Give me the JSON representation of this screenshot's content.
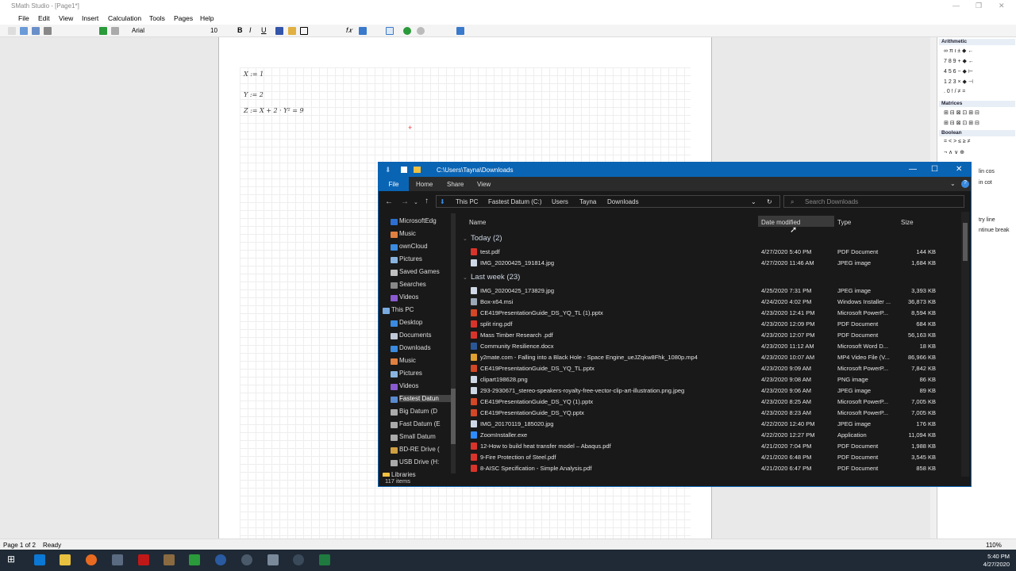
{
  "smath": {
    "title": "SMath Studio - [Page1*]",
    "menu": [
      "File",
      "Edit",
      "View",
      "Insert",
      "Calculation",
      "Tools",
      "Pages",
      "Help"
    ],
    "font_name": "Arial",
    "font_size": "10",
    "equations": [
      {
        "text": "X := 1"
      },
      {
        "text": "Y := 2"
      },
      {
        "text": "Z := X + 2 · Y² = 9"
      }
    ],
    "panels": [
      {
        "title": "Arithmetic",
        "rows": [
          "∞ π ι ± ◆ ←",
          "7 8 9 + ◆ ←",
          "4 5 6 − ◆ ⊢",
          "1 2 3 × ◆ ⊣",
          ". 0 ! / ≠ ="
        ]
      },
      {
        "title": "Matrices",
        "rows": [
          "⊞ ⊟ ⊠ ⊡ ⊞ ⊟",
          "⊞ ⊟ ⊠ ⊡ ⊞ ⊟"
        ]
      },
      {
        "title": "Boolean",
        "rows": [
          "= < > ≤ ≥ ≠",
          "¬ ∧ ∨ ⊕"
        ]
      }
    ],
    "panel_extra": [
      "lin cos",
      "in cot",
      "try line",
      "ntinue break"
    ],
    "status_left": "Page 1 of 2",
    "status_mid": "Ready",
    "zoom": "110%"
  },
  "explorer": {
    "path": "C:\\Users\\Tayna\\Downloads",
    "tabs": [
      "File",
      "Home",
      "Share",
      "View"
    ],
    "breadcrumb": [
      "This PC",
      "Fastest Datum (C:)",
      "Users",
      "Tayna",
      "Downloads"
    ],
    "search_placeholder": "Search Downloads",
    "columns": [
      "Name",
      "Date modified",
      "Type",
      "Size"
    ],
    "nav": [
      "MicrosoftEdg",
      "Music",
      "ownCloud",
      "Pictures",
      "Saved Games",
      "Searches",
      "Videos",
      "This PC",
      "Desktop",
      "Documents",
      "Downloads",
      "Music",
      "Pictures",
      "Videos",
      "Fastest Datun",
      "Big Datum (D",
      "Fast Datum (E",
      "Small Datum",
      "BD-RE Drive (",
      "USB Drive (H:",
      "Libraries"
    ],
    "groups": [
      {
        "label": "Today (2)",
        "files": [
          {
            "name": "test.pdf",
            "date": "4/27/2020 5:40 PM",
            "type": "PDF Document",
            "size": "144 KB",
            "kind": "pdf"
          },
          {
            "name": "IMG_20200425_191814.jpg",
            "date": "4/27/2020 11:46 AM",
            "type": "JPEG image",
            "size": "1,684 KB",
            "kind": "img"
          }
        ]
      },
      {
        "label": "Last week (23)",
        "files": [
          {
            "name": "IMG_20200425_173829.jpg",
            "date": "4/25/2020 7:31 PM",
            "type": "JPEG image",
            "size": "3,393 KB",
            "kind": "img"
          },
          {
            "name": "Box-x64.msi",
            "date": "4/24/2020 4:02 PM",
            "type": "Windows Installer ...",
            "size": "36,873 KB",
            "kind": "msi"
          },
          {
            "name": "CE419PresentationGuide_DS_YQ_TL (1).pptx",
            "date": "4/23/2020 12:41 PM",
            "type": "Microsoft PowerP...",
            "size": "8,594 KB",
            "kind": "ppt"
          },
          {
            "name": "split ring.pdf",
            "date": "4/23/2020 12:09 PM",
            "type": "PDF Document",
            "size": "684 KB",
            "kind": "pdf"
          },
          {
            "name": "Mass Timber Research .pdf",
            "date": "4/23/2020 12:07 PM",
            "type": "PDF Document",
            "size": "56,163 KB",
            "kind": "pdf"
          },
          {
            "name": "Community Resilience.docx",
            "date": "4/23/2020 11:12 AM",
            "type": "Microsoft Word D...",
            "size": "18 KB",
            "kind": "doc"
          },
          {
            "name": "y2mate.com - Falling into a Black Hole - Space Engine_ueJZqkw8Fhk_1080p.mp4",
            "date": "4/23/2020 10:07 AM",
            "type": "MP4 Video File (V...",
            "size": "86,966 KB",
            "kind": "vid"
          },
          {
            "name": "CE419PresentationGuide_DS_YQ_TL.pptx",
            "date": "4/23/2020 9:09 AM",
            "type": "Microsoft PowerP...",
            "size": "7,842 KB",
            "kind": "ppt"
          },
          {
            "name": "clipart198628.png",
            "date": "4/23/2020 9:08 AM",
            "type": "PNG image",
            "size": "86 KB",
            "kind": "img"
          },
          {
            "name": "293-2930671_stereo-speakers-royalty-free-vector-clip-art-illustration.png.jpeg",
            "date": "4/23/2020 9:06 AM",
            "type": "JPEG image",
            "size": "89 KB",
            "kind": "img"
          },
          {
            "name": "CE419PresentationGuide_DS_YQ (1).pptx",
            "date": "4/23/2020 8:25 AM",
            "type": "Microsoft PowerP...",
            "size": "7,005 KB",
            "kind": "ppt"
          },
          {
            "name": "CE419PresentationGuide_DS_YQ.pptx",
            "date": "4/23/2020 8:23 AM",
            "type": "Microsoft PowerP...",
            "size": "7,005 KB",
            "kind": "ppt"
          },
          {
            "name": "IMG_20170119_185020.jpg",
            "date": "4/22/2020 12:40 PM",
            "type": "JPEG image",
            "size": "176 KB",
            "kind": "img"
          },
          {
            "name": "ZoomInstaller.exe",
            "date": "4/22/2020 12:27 PM",
            "type": "Application",
            "size": "11,094 KB",
            "kind": "exe"
          },
          {
            "name": "12-How to build heat transfer model – Abaqus.pdf",
            "date": "4/21/2020 7:04 PM",
            "type": "PDF Document",
            "size": "1,988 KB",
            "kind": "pdf"
          },
          {
            "name": "9-Fire Protection of Steel.pdf",
            "date": "4/21/2020 6:48 PM",
            "type": "PDF Document",
            "size": "3,545 KB",
            "kind": "pdf"
          },
          {
            "name": "8-AISC Specification - Simple Analysis.pdf",
            "date": "4/21/2020 6:47 PM",
            "type": "PDF Document",
            "size": "858 KB",
            "kind": "pdf"
          }
        ]
      }
    ],
    "status": "117 items",
    "kind_colors": {
      "pdf": "#d9342b",
      "img": "#cfd8e6",
      "msi": "#9aa8b8",
      "ppt": "#d24726",
      "doc": "#2b5797",
      "vid": "#e0a030",
      "exe": "#2d8cff"
    }
  },
  "taskbar": {
    "time": "5:40 PM",
    "date": "4/27/2020"
  }
}
